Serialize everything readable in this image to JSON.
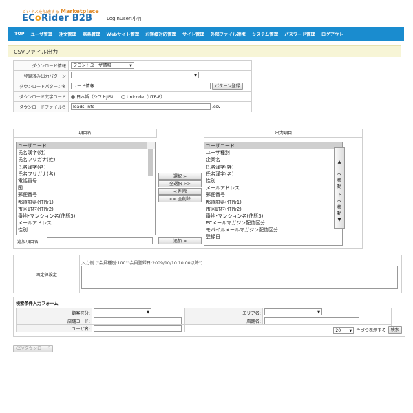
{
  "header": {
    "tagline": "ビジネスを加速する",
    "marketplace": "Marketplace",
    "logo_text_a": "EC",
    "logo_text_o": "o",
    "logo_text_b": "Rider B2B",
    "login_user": "LoginUser:小竹"
  },
  "nav": {
    "items": [
      "TOP",
      "ユーザ管理",
      "注文管理",
      "商品管理",
      "Webサイト管理",
      "お客様対応管理",
      "サイト管理",
      "外部ファイル連携",
      "システム管理",
      "パスワード管理",
      "ログアウト"
    ]
  },
  "page": {
    "title": "CSVファイル出力"
  },
  "form": {
    "download_info_label": "ダウンロード情報",
    "download_info_value": "フロントユーザ情報",
    "registered_pattern_label": "登録済み出力パターン",
    "registered_pattern_value": "",
    "pattern_name_label": "ダウンロードパターン名",
    "pattern_name_value": "リード情報",
    "pattern_register_button": "パターン登録",
    "charset_label": "ダウンロード文字コード",
    "charset_option_sjis": "日本語（シフトJIS）",
    "charset_option_utf8": "Unicode（UTF-8）",
    "filename_label": "ダウンロードファイル名",
    "filename_value": "leads_info",
    "filename_ext": ".csv"
  },
  "transfer": {
    "left_header": "項目名",
    "right_header": "出力項目",
    "left_items": [
      "ユーザコード",
      "氏名漢字(姓)",
      "氏名フリガナ(姓)",
      "氏名漢字(名)",
      "氏名フリガナ(名)",
      "電話番号",
      "国",
      "郵便番号",
      "都道府県(住所1)",
      "市区町村(住所2)",
      "番地･マンション名(住所3)",
      "メールアドレス",
      "性別"
    ],
    "right_items": [
      "ユーザコード",
      "ユーザ種別",
      "企業名",
      "氏名漢字(姓)",
      "氏名漢字(名)",
      "性別",
      "メールアドレス",
      "郵便番号",
      "都道府県(住所1)",
      "市区町村(住所2)",
      "番地･マンション名(住所3)",
      "PCメールマガジン配信区分",
      "モバイルメールマガジン配信区分",
      "登録日"
    ],
    "select_button": "選択 >",
    "select_all_button": "全選択 >>",
    "remove_button": "< 削除",
    "remove_all_button": "<< 全削除",
    "add_item_label": "追加項目名",
    "add_item_value": "",
    "add_button": "追加 >",
    "move_up": "▲上へ移動",
    "move_down": "下へ移動▼"
  },
  "condition": {
    "label": "固定値設定",
    "example": "入力例 (\"会員種別:100\"\"会員登録日:2009/10/10 10:00以降\")",
    "value": ""
  },
  "search": {
    "title": "検索条件入力フォーム",
    "customer_type_label": "顧客区分:",
    "area_label": "エリア名:",
    "store_code_label": "店舗コード:",
    "store_name_label": "店舗名:",
    "user_name_label": "ユーザ名:",
    "per_page_value": "20",
    "per_page_label": "件づつ表示する",
    "search_button": "検索"
  },
  "csv_download_button": "CSVダウンロード"
}
